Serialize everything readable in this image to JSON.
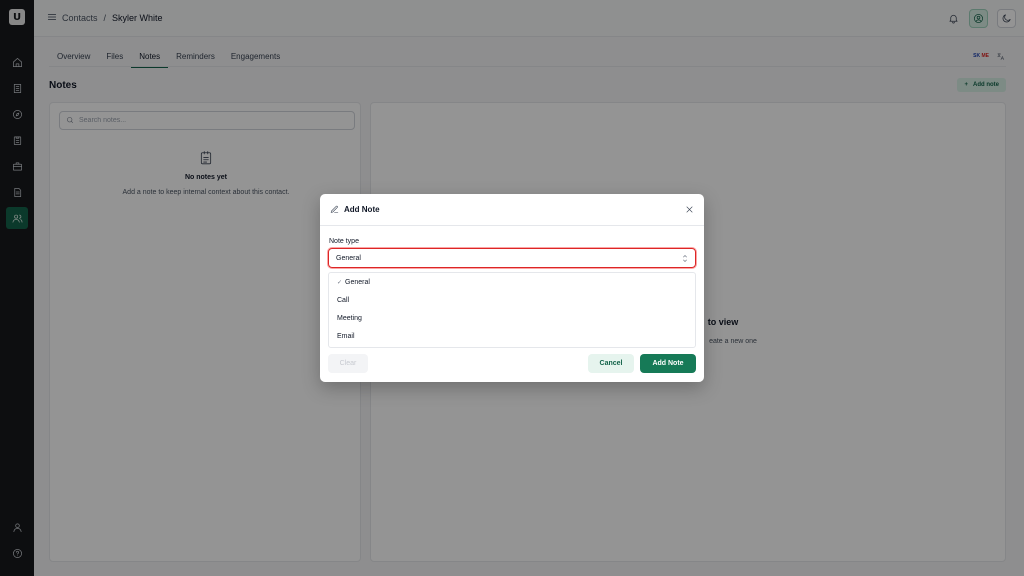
{
  "app": {
    "logo_letter": "U"
  },
  "breadcrumb": {
    "parent": "Contacts",
    "separator": "/",
    "current": "Skyler White"
  },
  "tabs": [
    {
      "label": "Overview",
      "active": false
    },
    {
      "label": "Files",
      "active": false
    },
    {
      "label": "Notes",
      "active": true
    },
    {
      "label": "Reminders",
      "active": false
    },
    {
      "label": "Engagements",
      "active": false
    }
  ],
  "language": {
    "flag_text_a": "SK",
    "flag_text_b": "ME"
  },
  "notes": {
    "heading": "Notes",
    "add_note_label": "Add note",
    "search_placeholder": "Search notes...",
    "empty_title": "No notes yet",
    "empty_subtitle": "Add a note to keep internal context about this contact."
  },
  "detail_panel": {
    "title_fragment": "to view",
    "subtitle_fragment": "eate a new one"
  },
  "modal": {
    "title": "Add Note",
    "field_label": "Note type",
    "selected_value": "General",
    "options": [
      {
        "label": "General",
        "selected": true
      },
      {
        "label": "Call",
        "selected": false
      },
      {
        "label": "Meeting",
        "selected": false
      },
      {
        "label": "Email",
        "selected": false
      }
    ],
    "clear_label": "Clear",
    "cancel_label": "Cancel",
    "submit_label": "Add Note"
  },
  "colors": {
    "brand": "#14634a",
    "sidebar": "#17191c",
    "error_border": "#dc2626"
  }
}
